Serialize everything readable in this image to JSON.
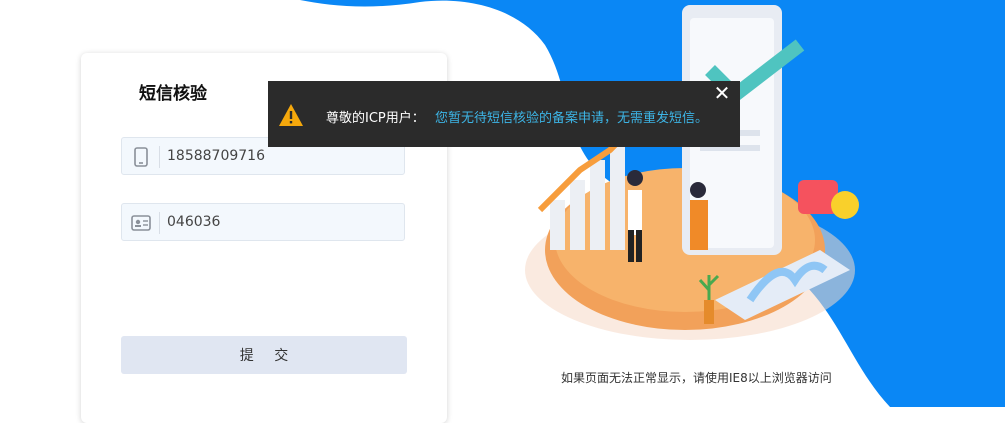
{
  "card": {
    "title": "短信核验",
    "phone": {
      "value": "18588709716",
      "icon": "phone-icon"
    },
    "code": {
      "value": "046036",
      "icon": "id-card-icon"
    },
    "submit_label": "提 交"
  },
  "toast": {
    "label": "尊敬的ICP用户：",
    "message": "您暂无待短信核验的备案申请，无需重发短信。",
    "close": "✕",
    "icon": "warning-icon"
  },
  "footer": {
    "browser_note": "如果页面无法正常显示，请使用IE8以上浏览器访问"
  },
  "colors": {
    "accent_blue": "#0a87f5",
    "toast_bg": "#2b2b2b",
    "toast_msg": "#3db5e6",
    "submit_bg": "#e0e6f2"
  }
}
